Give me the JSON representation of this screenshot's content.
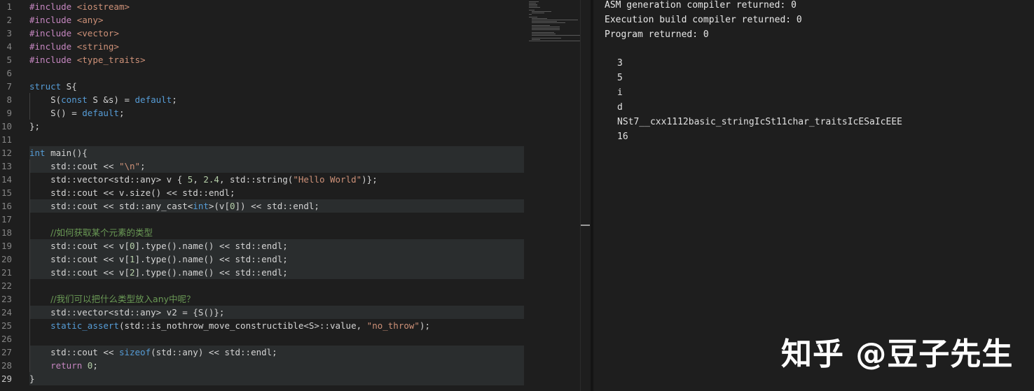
{
  "editor": {
    "active_line": 29,
    "line_numbers": [
      "1",
      "2",
      "3",
      "4",
      "5",
      "6",
      "7",
      "8",
      "9",
      "10",
      "11",
      "12",
      "13",
      "14",
      "15",
      "16",
      "17",
      "18",
      "19",
      "20",
      "21",
      "22",
      "23",
      "24",
      "25",
      "26",
      "27",
      "28",
      "29"
    ],
    "code": {
      "l1": {
        "kw": "#include",
        "rest": " <iostream>"
      },
      "l2": {
        "kw": "#include",
        "rest": " <any>"
      },
      "l3": {
        "kw": "#include",
        "rest": " <vector>"
      },
      "l4": {
        "kw": "#include",
        "rest": " <string>"
      },
      "l5": {
        "kw": "#include",
        "rest": " <type_traits>"
      },
      "l7": {
        "kw": "struct",
        "rest": " S{"
      },
      "l8": {
        "a": "    S(",
        "b": "const",
        "c": " S &s) = ",
        "d": "default",
        "e": ";"
      },
      "l9": {
        "a": "    S() = ",
        "b": "default",
        "c": ";"
      },
      "l10": {
        "a": "};"
      },
      "l12": {
        "kw": "int",
        "rest": " main(){"
      },
      "l13": {
        "a": "    std::cout << ",
        "b": "\"\\n\"",
        "c": ";"
      },
      "l14": {
        "a": "    std::vector<std::any> v { ",
        "b": "5",
        "c": ", ",
        "d": "2.4",
        "e": ", std::string(",
        "f": "\"Hello World\"",
        "g": ")};"
      },
      "l15": {
        "a": "    std::cout << v.size() << std::endl;"
      },
      "l16": {
        "a": "    std::cout << std::any_cast<",
        "b": "int",
        "c": ">(v[",
        "d": "0",
        "e": "]) << std::endl;"
      },
      "l18": {
        "a": "    ",
        "b": "//如何获取某个元素的类型"
      },
      "l19": {
        "a": "    std::cout << v[",
        "b": "0",
        "c": "].type().name() << std::endl;"
      },
      "l20": {
        "a": "    std::cout << v[",
        "b": "1",
        "c": "].type().name() << std::endl;"
      },
      "l21": {
        "a": "    std::cout << v[",
        "b": "2",
        "c": "].type().name() << std::endl;"
      },
      "l23": {
        "a": "    ",
        "b": "//我们可以把什么类型放入any中呢？"
      },
      "l24": {
        "a": "    std::vector<std::any> v2 = {S()};"
      },
      "l25": {
        "a": "    ",
        "b": "static_assert",
        "c": "(std::is_nothrow_move_constructible<S>::value, ",
        "d": "\"no_throw\"",
        "e": ");"
      },
      "l27": {
        "a": "    std::cout << ",
        "b": "sizeof",
        "c": "(std::any) << std::endl;"
      },
      "l28": {
        "a": "    ",
        "b": "return",
        "c": " ",
        "d": "0",
        "e": ";"
      },
      "l29": {
        "a": "}"
      }
    }
  },
  "output": {
    "status": [
      "ASM generation compiler returned: 0",
      "Execution build compiler returned: 0",
      "Program returned: 0"
    ],
    "stdout": [
      "3",
      "5",
      "i",
      "d",
      "NSt7__cxx1112basic_stringIcSt11char_traitsIcESaIcEEE",
      "16"
    ]
  },
  "watermark": "知乎 @豆子先生"
}
